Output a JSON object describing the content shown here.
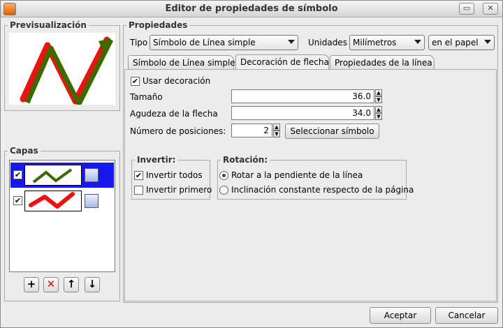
{
  "window": {
    "title": "Editor de propiedades de símbolo"
  },
  "preview": {
    "legend": "Previsualización"
  },
  "layers": {
    "legend": "Capas",
    "items": [
      {
        "checked": true,
        "selected": true,
        "color": "#3a6a00"
      },
      {
        "checked": true,
        "selected": false,
        "color": "#ee1111"
      }
    ]
  },
  "props": {
    "legend": "Propiedades",
    "type_label": "Tipo",
    "type_value": "Símbolo de Línea simple",
    "units_label": "Unidades",
    "units_value": "Milímetros",
    "reference_value": "en el papel"
  },
  "tabs": [
    {
      "label": "Símbolo de Línea simple"
    },
    {
      "label": "Decoración de flecha"
    },
    {
      "label": "Propiedades de la línea"
    }
  ],
  "decoration": {
    "use_label": "Usar decoración",
    "size_label": "Tamaño",
    "size_value": "36.0",
    "sharp_label": "Agudeza de la flecha",
    "sharp_value": "34.0",
    "positions_label": "Número de posiciones:",
    "positions_value": "2",
    "select_symbol": "Seleccionar símbolo"
  },
  "invert": {
    "legend": "Invertir:",
    "all_label": "Invertir todos",
    "first_label": "Invertir primero"
  },
  "rotation": {
    "legend": "Rotación:",
    "slope_label": "Rotar a la pendiente de la línea",
    "constant_label": "Inclinación constante respecto de la página"
  },
  "footer": {
    "accept": "Aceptar",
    "cancel": "Cancelar"
  },
  "colors": {
    "selection": "#1818ee",
    "red": "#ee1111",
    "green": "#3a6a00"
  }
}
